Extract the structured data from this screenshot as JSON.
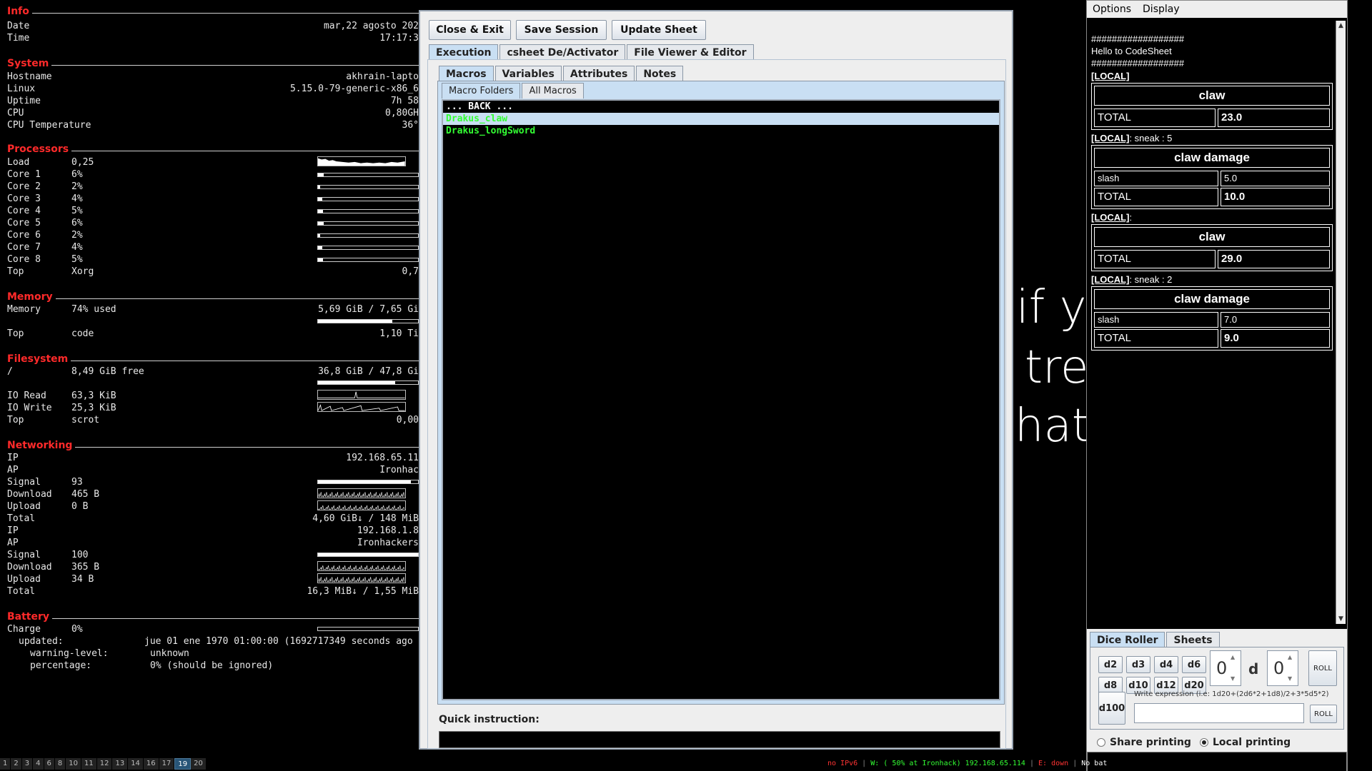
{
  "conky": {
    "info": {
      "title": "Info",
      "date_label": "Date",
      "date_value": "mar,22 agosto 202",
      "time_label": "Time",
      "time_value": "17:17:3"
    },
    "system": {
      "title": "System",
      "rows": [
        {
          "k": "Hostname",
          "v": "akhrain-lapto"
        },
        {
          "k": "Linux",
          "v": "5.15.0-79-generic-x86_6"
        },
        {
          "k": "Uptime",
          "v": "7h 58"
        },
        {
          "k": "CPU",
          "v": "0,80GH"
        },
        {
          "k": "CPU Temperature",
          "v": "36°"
        }
      ]
    },
    "processors": {
      "title": "Processors",
      "load_label": "Load",
      "load_value": "0,25",
      "cores": [
        {
          "k": "Core 1",
          "v": "6%",
          "pct": 6
        },
        {
          "k": "Core 2",
          "v": "2%",
          "pct": 2
        },
        {
          "k": "Core 3",
          "v": "4%",
          "pct": 4
        },
        {
          "k": "Core 4",
          "v": "5%",
          "pct": 5
        },
        {
          "k": "Core 5",
          "v": "6%",
          "pct": 6
        },
        {
          "k": "Core 6",
          "v": "2%",
          "pct": 2
        },
        {
          "k": "Core 7",
          "v": "4%",
          "pct": 4
        },
        {
          "k": "Core 8",
          "v": "5%",
          "pct": 5
        }
      ],
      "top_label": "Top",
      "top_proc": "Xorg",
      "top_value": "0,7"
    },
    "memory": {
      "title": "Memory",
      "label": "Memory",
      "used": "74% used",
      "amount": "5,69 GiB / 7,65 Gi",
      "pct": 74,
      "top_label": "Top",
      "top_proc": "code",
      "top_value": "1,10 Ti"
    },
    "filesystem": {
      "title": "Filesystem",
      "root_label": "/",
      "free": "8,49 GiB free",
      "amount": "36,8 GiB / 47,8 Gi",
      "pct": 77,
      "io_read_label": "IO Read",
      "io_read_value": "63,3 KiB",
      "io_write_label": "IO Write",
      "io_write_value": "25,3 KiB",
      "top_label": "Top",
      "top_proc": "scrot",
      "top_value": "0,00"
    },
    "networking": {
      "title": "Networking",
      "ifaces": [
        {
          "ip_label": "IP",
          "ip": "192.168.65.11",
          "ap_label": "AP",
          "ap": "Ironhac",
          "signal_label": "Signal",
          "signal": "93",
          "signal_pct": 93,
          "down_label": "Download",
          "down": "465 B",
          "up_label": "Upload",
          "up": "0 B",
          "total_label": "Total",
          "total": "4,60 GiB↓ / 148 MiB"
        },
        {
          "ip_label": "IP",
          "ip": "192.168.1.8",
          "ap_label": "AP",
          "ap": "Ironhackers",
          "signal_label": "Signal",
          "signal": "100",
          "signal_pct": 100,
          "down_label": "Download",
          "down": "365 B",
          "up_label": "Upload",
          "up": "34 B",
          "total_label": "Total",
          "total": "16,3 MiB↓ / 1,55 MiB"
        }
      ]
    },
    "battery": {
      "title": "Battery",
      "charge_label": "Charge",
      "charge": "0%",
      "pct": 0,
      "updated_label": "updated:",
      "updated": "jue 01 ene 1970 01:00:00 (1692717349 seconds ago",
      "warning_label": "warning-level:",
      "warning": "unknown",
      "percentage_label": "percentage:",
      "percentage": "0% (should be ignored)"
    }
  },
  "background_text": [
    "if yo",
    "tree",
    "hat"
  ],
  "dialog": {
    "buttons": {
      "close_exit": "Close & Exit",
      "save_session": "Save Session",
      "update_sheet": "Update Sheet"
    },
    "main_tabs": [
      "Execution",
      "csheet De/Activator",
      "File Viewer & Editor"
    ],
    "sub_tabs": [
      "Macros",
      "Variables",
      "Attributes",
      "Notes"
    ],
    "macro_tabs": [
      "Macro Folders",
      "All Macros"
    ],
    "macro_list": [
      {
        "label": "... BACK ...",
        "color": "#ffffff",
        "selected": false
      },
      {
        "label": "Drakus_claw",
        "color": "#33ff33",
        "selected": true
      },
      {
        "label": "Drakus_longSword",
        "color": "#33ff33",
        "selected": false
      }
    ],
    "quick_label": "Quick instruction:",
    "quick_value": ""
  },
  "codesheet": {
    "menu": [
      "Options",
      "Display"
    ],
    "hashes": "##################",
    "hello": "Hello to CodeSheet",
    "entries": [
      {
        "tag": "[LOCAL]",
        "extra": "",
        "title": "claw",
        "rows": [],
        "total_label": "TOTAL",
        "total": "23.0"
      },
      {
        "tag": "[LOCAL]",
        "extra": ": sneak : 5",
        "title": "claw damage",
        "rows": [
          {
            "k": "slash",
            "v": "5.0"
          }
        ],
        "total_label": "TOTAL",
        "total": "10.0"
      },
      {
        "tag": "[LOCAL]",
        "extra": ":",
        "title": "claw",
        "rows": [],
        "total_label": "TOTAL",
        "total": "29.0"
      },
      {
        "tag": "[LOCAL]",
        "extra": ": sneak : 2",
        "title": "claw damage",
        "rows": [
          {
            "k": "slash",
            "v": "7.0"
          }
        ],
        "total_label": "TOTAL",
        "total": "9.0"
      }
    ],
    "bottom_tabs": [
      "Dice Roller",
      "Sheets"
    ],
    "dice": [
      "d2",
      "d3",
      "d4",
      "d6",
      "d8",
      "d10",
      "d12",
      "d20"
    ],
    "d100": "d100",
    "count_value": "0",
    "d_label": "d",
    "sides_value": "0",
    "roll": "ROLL",
    "expr_hint": "Write expression (i.e: 1d20+(2d6*2+1d8)/2+3*5d5*2)",
    "expr_value": "",
    "share_printing": "Share printing",
    "local_printing": "Local printing"
  },
  "statusbar": {
    "workspaces": [
      "1",
      "2",
      "3",
      "4",
      "6",
      "8",
      "10",
      "11",
      "12",
      "13",
      "14",
      "16",
      "17",
      "19",
      "20"
    ],
    "current": "19",
    "ipv6": "no IPv6",
    "wifi": "W: ( 50% at Ironhack) 192.168.65.114",
    "eth": "E: down",
    "battery": "No bat"
  },
  "colors": {
    "conky_title": "#ff2a2a",
    "macro_green": "#33ff33",
    "tab_selected": "#c9dff3",
    "status_red": "#ff3333",
    "status_green": "#33ff33"
  }
}
